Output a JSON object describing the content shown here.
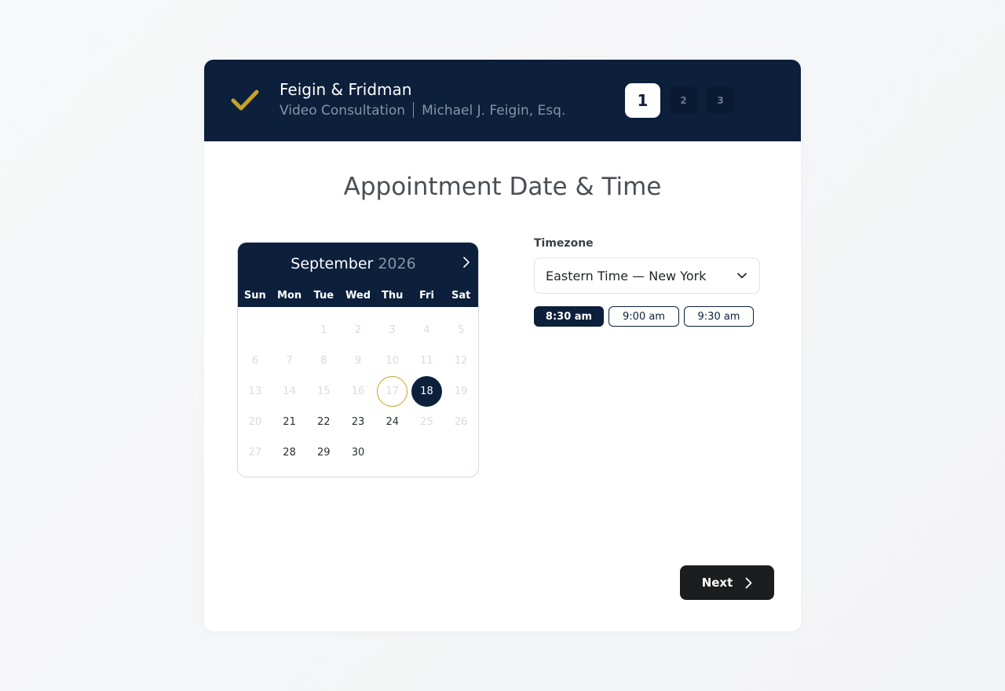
{
  "header": {
    "firm_name": "Feigin & Fridman",
    "service": "Video Consultation",
    "attorney": "Michael J. Feigin, Esq.",
    "steps": [
      "1",
      "2",
      "3"
    ],
    "active_step": "1"
  },
  "page": {
    "title": "Appointment Date & Time"
  },
  "calendar": {
    "month": "September",
    "year": "2026",
    "weekdays": [
      "Sun",
      "Mon",
      "Tue",
      "Wed",
      "Thu",
      "Fri",
      "Sat"
    ],
    "weeks": [
      [
        "",
        "",
        "1",
        "2",
        "3",
        "4",
        "5"
      ],
      [
        "6",
        "7",
        "8",
        "9",
        "10",
        "11",
        "12"
      ],
      [
        "13",
        "14",
        "15",
        "16",
        "17",
        "18",
        "19"
      ],
      [
        "20",
        "21",
        "22",
        "23",
        "24",
        "25",
        "26"
      ],
      [
        "27",
        "28",
        "29",
        "30",
        "",
        "",
        ""
      ]
    ],
    "available_days": [
      "18",
      "21",
      "22",
      "23",
      "24",
      "28",
      "29",
      "30"
    ],
    "today": "17",
    "selected": "18"
  },
  "timezone": {
    "label": "Timezone",
    "value": "Eastern Time — New York"
  },
  "time_slots": [
    {
      "label": "8:30 am",
      "active": true
    },
    {
      "label": "9:00 am",
      "active": false
    },
    {
      "label": "9:30 am",
      "active": false
    }
  ],
  "actions": {
    "next_label": "Next"
  },
  "colors": {
    "navy": "#0c1f3b",
    "gold": "#c9a227",
    "button_dark": "#1c1d1f"
  }
}
